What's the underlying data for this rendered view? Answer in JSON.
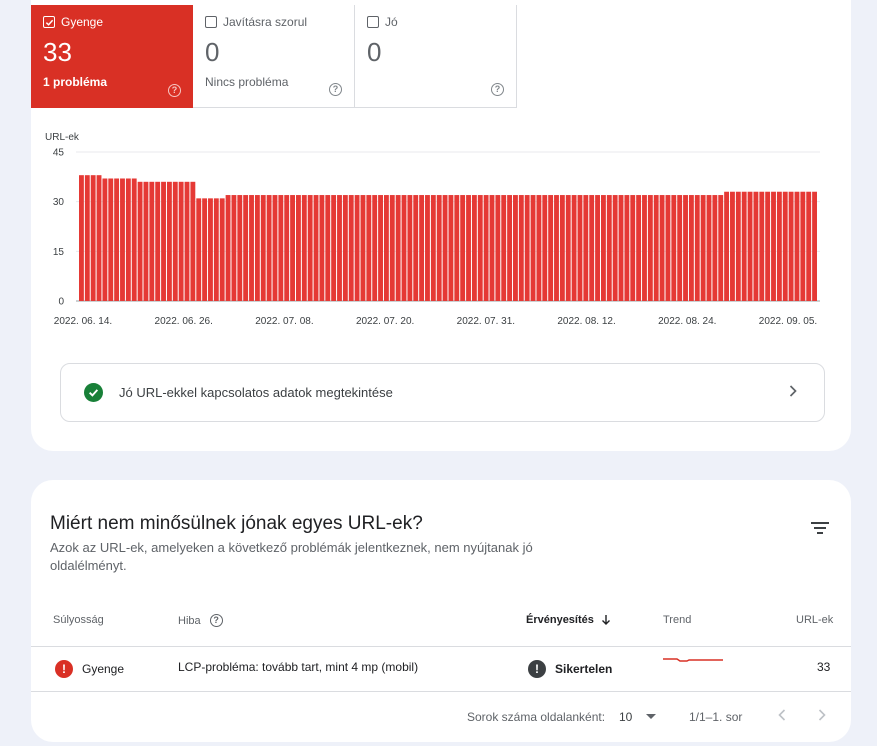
{
  "tiles": {
    "poor": {
      "label": "Gyenge",
      "count": "33",
      "sub": "1 probléma"
    },
    "needs_improvement": {
      "label": "Javításra szorul",
      "count": "0",
      "sub": "Nincs probléma"
    },
    "good": {
      "label": "Jó",
      "count": "0",
      "sub": ""
    }
  },
  "chart_data": {
    "type": "bar",
    "ylabel": "URL-ek",
    "ylim": [
      0,
      45
    ],
    "yticks": [
      "45",
      "30",
      "15",
      "0"
    ],
    "xtick_labels": [
      "2022. 06. 14.",
      "2022. 06. 26.",
      "2022. 07. 08.",
      "2022. 07. 20.",
      "2022. 07. 31.",
      "2022. 08. 12.",
      "2022. 08. 24.",
      "2022. 09. 05."
    ],
    "values": [
      38,
      38,
      38,
      38,
      37,
      37,
      37,
      37,
      37,
      37,
      36,
      36,
      36,
      36,
      36,
      36,
      36,
      36,
      36,
      36,
      31,
      31,
      31,
      31,
      31,
      32,
      32,
      32,
      32,
      32,
      32,
      32,
      32,
      32,
      32,
      32,
      32,
      32,
      32,
      32,
      32,
      32,
      32,
      32,
      32,
      32,
      32,
      32,
      32,
      32,
      32,
      32,
      32,
      32,
      32,
      32,
      32,
      32,
      32,
      32,
      32,
      32,
      32,
      32,
      32,
      32,
      32,
      32,
      32,
      32,
      32,
      32,
      32,
      32,
      32,
      32,
      32,
      32,
      32,
      32,
      32,
      32,
      32,
      32,
      32,
      32,
      32,
      32,
      32,
      32,
      32,
      32,
      32,
      32,
      32,
      32,
      32,
      32,
      32,
      32,
      32,
      32,
      32,
      32,
      32,
      32,
      32,
      32,
      32,
      32,
      33,
      33,
      33,
      33,
      33,
      33,
      33,
      33,
      33,
      33,
      33,
      33,
      33,
      33,
      33,
      33
    ],
    "bar_color": "#e53935"
  },
  "good_link": {
    "label": "Jó URL-ekkel kapcsolatos adatok megtekintése"
  },
  "issues": {
    "title": "Miért nem minősülnek jónak egyes URL-ek?",
    "description": "Azok az URL-ek, amelyeken a következő problémák jelentkeznek, nem nyújtanak jó oldalélményt.",
    "columns": {
      "severity": "Súlyosság",
      "issue": "Hiba",
      "validation": "Érvényesítés",
      "trend": "Trend",
      "urls": "URL-ek"
    },
    "rows": [
      {
        "severity": "Gyenge",
        "issue": "LCP-probléma: tovább tart, mint 4 mp (mobil)",
        "validation": "Sikertelen",
        "urls": "33"
      }
    ],
    "footer": {
      "rows_per_page_label": "Sorok száma oldalanként:",
      "rows_per_page": "10",
      "range": "1/1–1. sor"
    }
  },
  "colors": {
    "poor": "#d93025",
    "good": "#188038",
    "validation_failed": "#3c4043"
  }
}
